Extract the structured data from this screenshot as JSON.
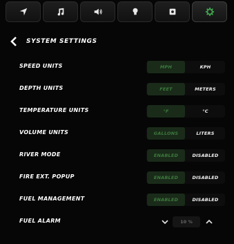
{
  "tabs": [
    {
      "icon": "navigation-arrow-icon"
    },
    {
      "icon": "music-note-icon"
    },
    {
      "icon": "speaker-icon"
    },
    {
      "icon": "lightbulb-icon"
    },
    {
      "icon": "camera-icon"
    },
    {
      "icon": "gear-icon",
      "active": true
    }
  ],
  "header": {
    "title": "SYSTEM SETTINGS"
  },
  "settings": [
    {
      "label": "SPEED UNITS",
      "left": "MPH",
      "right": "KPH",
      "selected": "left"
    },
    {
      "label": "DEPTH UNITS",
      "left": "FEET",
      "right": "METERS",
      "selected": "left"
    },
    {
      "label": "TEMPERATURE UNITS",
      "left": "°F",
      "right": "°C",
      "selected": "left"
    },
    {
      "label": "VOLUME UNITS",
      "left": "GALLONS",
      "right": "LITERS",
      "selected": "left"
    },
    {
      "label": "RIVER MODE",
      "left": "ENABLED",
      "right": "DISABLED",
      "selected": "left"
    },
    {
      "label": "FIRE EXT. POPUP",
      "left": "ENABLED",
      "right": "DISABLED",
      "selected": "left"
    },
    {
      "label": "FUEL MANAGEMENT",
      "left": "ENABLED",
      "right": "DISABLED",
      "selected": "left"
    }
  ],
  "fuel_alarm": {
    "label": "FUEL ALARM",
    "value": "10 %"
  },
  "colors": {
    "accent_green": "#3c7a3c",
    "selected_bg": "#1a2b1a",
    "gear_green": "#3fa34d"
  }
}
